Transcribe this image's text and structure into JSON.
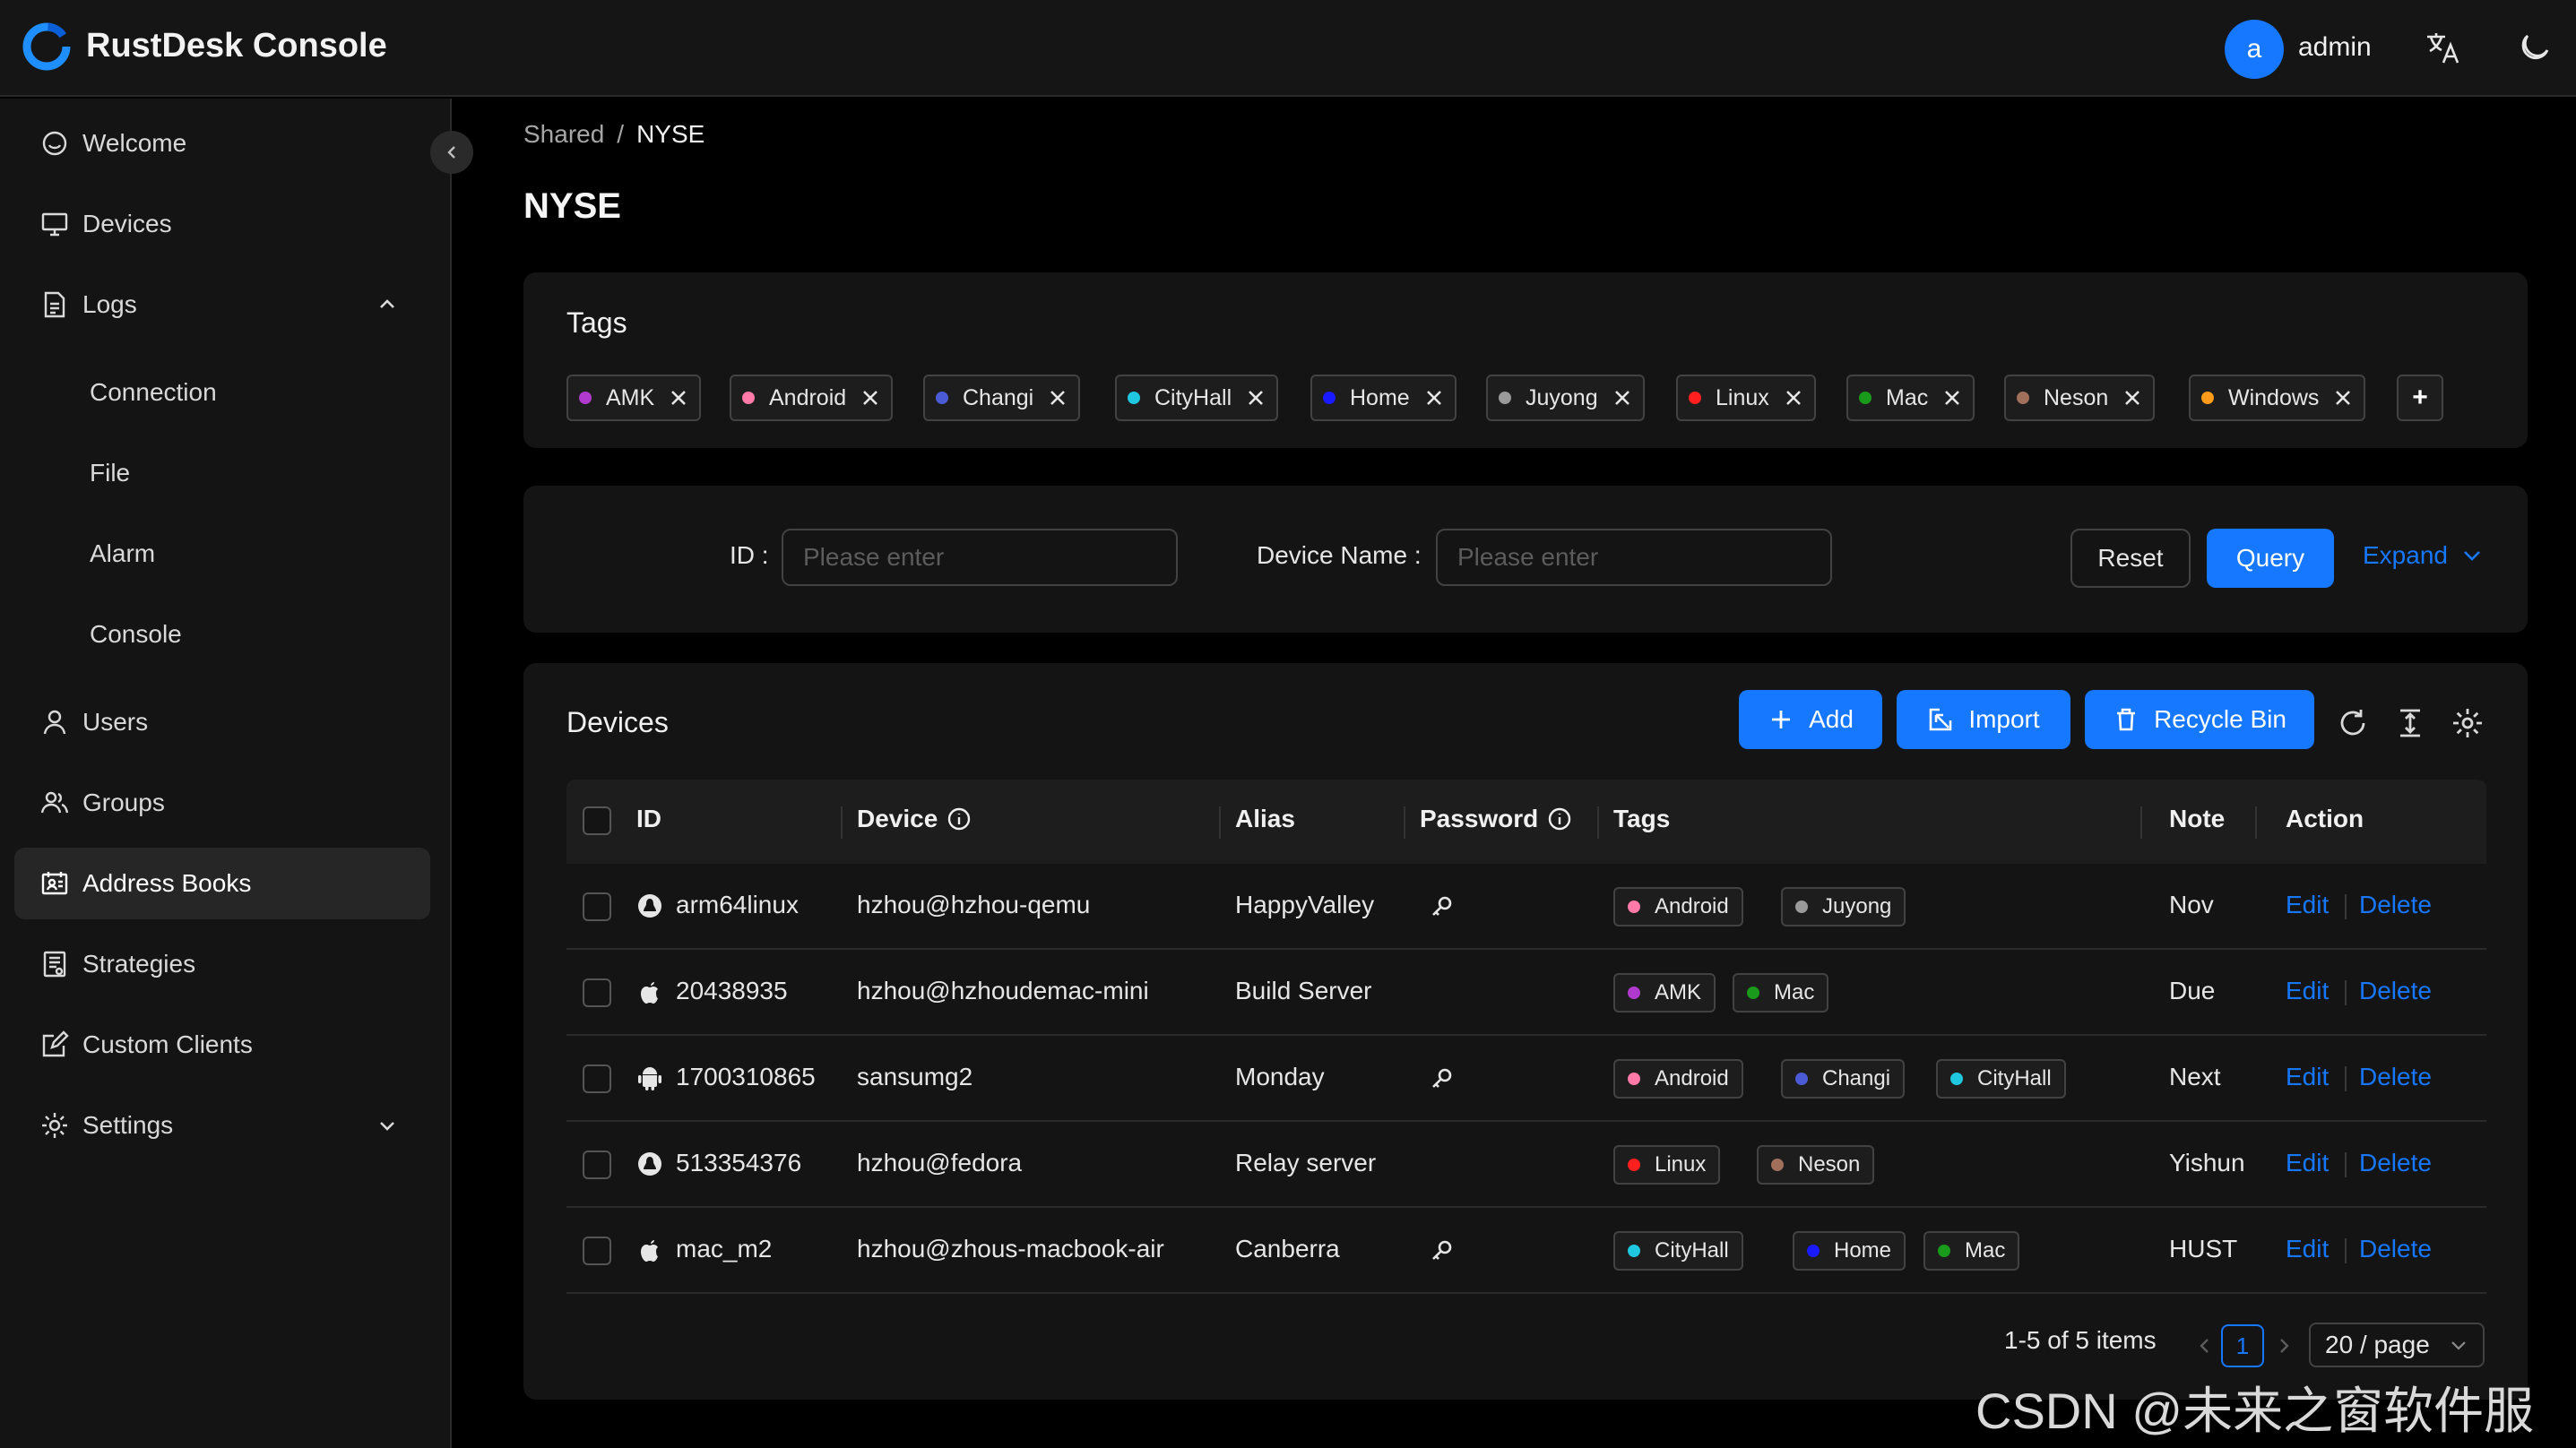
{
  "header": {
    "title": "RustDesk Console",
    "avatar_letter": "a",
    "user": "admin"
  },
  "sidebar": {
    "items": [
      {
        "label": "Welcome"
      },
      {
        "label": "Devices"
      },
      {
        "label": "Logs"
      },
      {
        "label": "Connection"
      },
      {
        "label": "File"
      },
      {
        "label": "Alarm"
      },
      {
        "label": "Console"
      },
      {
        "label": "Users"
      },
      {
        "label": "Groups"
      },
      {
        "label": "Address Books"
      },
      {
        "label": "Strategies"
      },
      {
        "label": "Custom Clients"
      },
      {
        "label": "Settings"
      }
    ],
    "active": "Address Books"
  },
  "breadcrumb": {
    "parent": "Shared",
    "sep": "/",
    "current": "NYSE"
  },
  "page_title": "NYSE",
  "tags_card": {
    "title": "Tags",
    "tags": [
      {
        "name": "AMK",
        "color": "#b03acd"
      },
      {
        "name": "Android",
        "color": "#ff7aa8"
      },
      {
        "name": "Changi",
        "color": "#4b5bd6"
      },
      {
        "name": "CityHall",
        "color": "#1fc7e0"
      },
      {
        "name": "Home",
        "color": "#1a1aff"
      },
      {
        "name": "Juyong",
        "color": "#9a9a9a"
      },
      {
        "name": "Linux",
        "color": "#ff1f1f"
      },
      {
        "name": "Mac",
        "color": "#1a9a1a"
      },
      {
        "name": "Neson",
        "color": "#a0705a"
      },
      {
        "name": "Windows",
        "color": "#ff9a1a"
      }
    ],
    "add_label": "+"
  },
  "query": {
    "id_label": "ID",
    "id_placeholder": "Please enter",
    "name_label": "Device Name",
    "name_placeholder": "Please enter",
    "reset": "Reset",
    "query": "Query",
    "expand": "Expand"
  },
  "devices": {
    "title": "Devices",
    "add": "Add",
    "import": "Import",
    "recycle": "Recycle Bin",
    "columns": {
      "id": "ID",
      "device": "Device",
      "alias": "Alias",
      "password": "Password",
      "tags": "Tags",
      "note": "Note",
      "action": "Action"
    },
    "rows": [
      {
        "os": "linux",
        "id": "arm64linux",
        "device": "hzhou@hzhou-qemu",
        "alias": "HappyValley",
        "pw": true,
        "tags": [
          "Android",
          "Juyong"
        ],
        "note": "Nov",
        "edit": "Edit",
        "delete": "Delete"
      },
      {
        "os": "mac",
        "id": "20438935",
        "device": "hzhou@hzhoudemac-mini",
        "alias": "Build Server",
        "pw": false,
        "tags": [
          "AMK",
          "Mac"
        ],
        "note": "Due",
        "edit": "Edit",
        "delete": "Delete"
      },
      {
        "os": "android",
        "id": "1700310865",
        "device": "sansumg2",
        "alias": "Monday",
        "pw": true,
        "tags": [
          "Android",
          "Changi",
          "CityHall"
        ],
        "note": "Next",
        "edit": "Edit",
        "delete": "Delete"
      },
      {
        "os": "linux",
        "id": "513354376",
        "device": "hzhou@fedora",
        "alias": "Relay server",
        "pw": false,
        "tags": [
          "Linux",
          "Neson"
        ],
        "note": "Yishun",
        "edit": "Edit",
        "delete": "Delete"
      },
      {
        "os": "mac",
        "id": "mac_m2",
        "device": "hzhou@zhous-macbook-air",
        "alias": "Canberra",
        "pw": true,
        "tags": [
          "CityHall",
          "Home",
          "Mac"
        ],
        "note": "HUST",
        "edit": "Edit",
        "delete": "Delete"
      }
    ],
    "pagination": {
      "total": "1-5 of 5 items",
      "page": "1",
      "page_size": "20 / page"
    }
  },
  "watermark": "CSDN @未来之窗软件服务",
  "colors": {
    "primary": "#1677ff",
    "bg": "#000000",
    "card": "#141414"
  }
}
